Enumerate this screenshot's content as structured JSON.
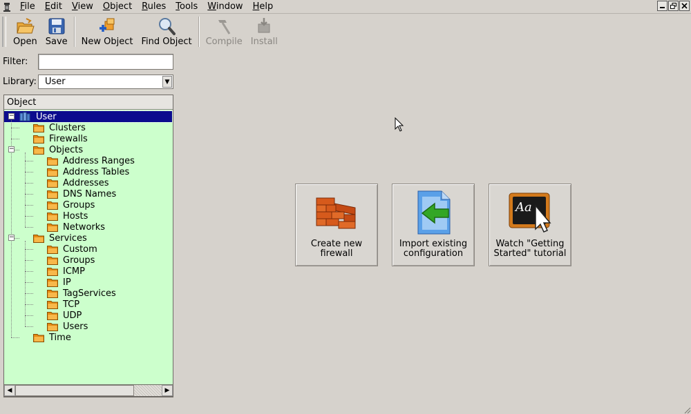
{
  "menu": {
    "items": [
      {
        "underline": "F",
        "rest": "ile"
      },
      {
        "underline": "E",
        "rest": "dit"
      },
      {
        "underline": "V",
        "rest": "iew"
      },
      {
        "underline": "O",
        "rest": "bject"
      },
      {
        "underline": "R",
        "rest": "ules"
      },
      {
        "underline": "T",
        "rest": "ools"
      },
      {
        "underline": "W",
        "rest": "indow"
      },
      {
        "underline": "H",
        "rest": "elp"
      }
    ]
  },
  "toolbar": {
    "open": "Open",
    "save": "Save",
    "new_object": "New Object",
    "find_object": "Find Object",
    "compile": "Compile",
    "install": "Install"
  },
  "filter": {
    "label": "Filter:",
    "value": ""
  },
  "library": {
    "label": "Library:",
    "value": "User"
  },
  "tree": {
    "header": "Object",
    "root": "User",
    "items": [
      "Clusters",
      "Firewalls",
      "Objects",
      "Address Ranges",
      "Address Tables",
      "Addresses",
      "DNS Names",
      "Groups",
      "Hosts",
      "Networks",
      "Services",
      "Custom",
      "Groups",
      "ICMP",
      "IP",
      "TagServices",
      "TCP",
      "UDP",
      "Users",
      "Time"
    ]
  },
  "welcome": {
    "create_line1": "Create new",
    "create_line2": "firewall",
    "import_line1": "Import existing",
    "import_line2": "configuration",
    "watch_line1": "Watch \"Getting",
    "watch_line2": "Started\" tutorial"
  },
  "colors": {
    "tree_background": "#ccffcc",
    "selection": "#0c0c8e",
    "folder": "#f5a623"
  }
}
